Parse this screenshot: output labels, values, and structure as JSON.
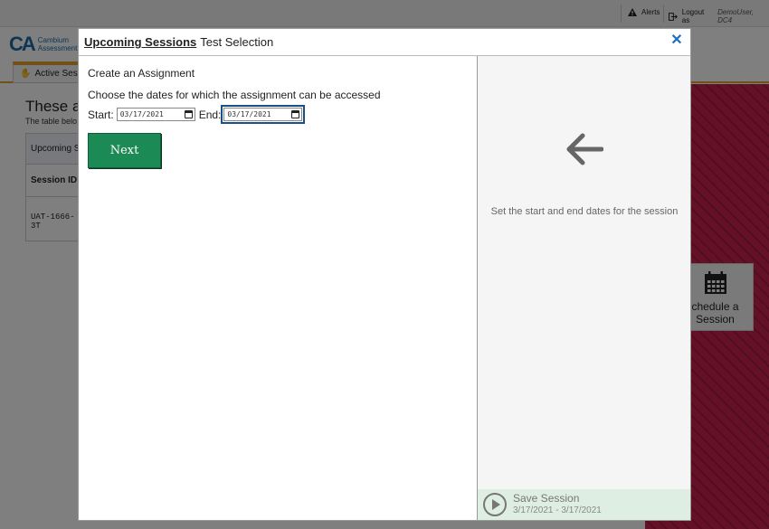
{
  "topbar": {
    "alerts_label": "Alerts",
    "logout_label": "Logout as",
    "user_name": "DemoUser, DC4"
  },
  "brand": {
    "logo_mark": "CA",
    "logo_line1": "Cambium",
    "logo_line2": "Assessment"
  },
  "background": {
    "active_tab_label": "Active Sessi",
    "heading": "These a",
    "subtext": "The table belo",
    "table_caption": "Upcoming S",
    "table_header": "Session ID",
    "table_cell": "UAT-1666-3T",
    "schedule_label_line1": "chedule a",
    "schedule_label_line2": "Session",
    "accent_color": "#e2a32a",
    "stripe_color": "#c8224f"
  },
  "modal": {
    "title_main": "Upcoming Sessions",
    "title_sub": "Test Selection",
    "close_glyph": "✕",
    "create_label": "Create an Assignment",
    "choose_label": "Choose the dates for which the assignment can be accessed",
    "start_label": "Start:",
    "start_value": "03/17/2021",
    "end_label": "End:",
    "end_value": "03/17/2021",
    "next_label": "Next",
    "hint_text": "Set the start and end dates for the session",
    "save_title": "Save Session",
    "save_dates": "3/17/2021 - 3/17/2021",
    "button_color": "#1c8a55",
    "close_color": "#1f6fc0"
  }
}
